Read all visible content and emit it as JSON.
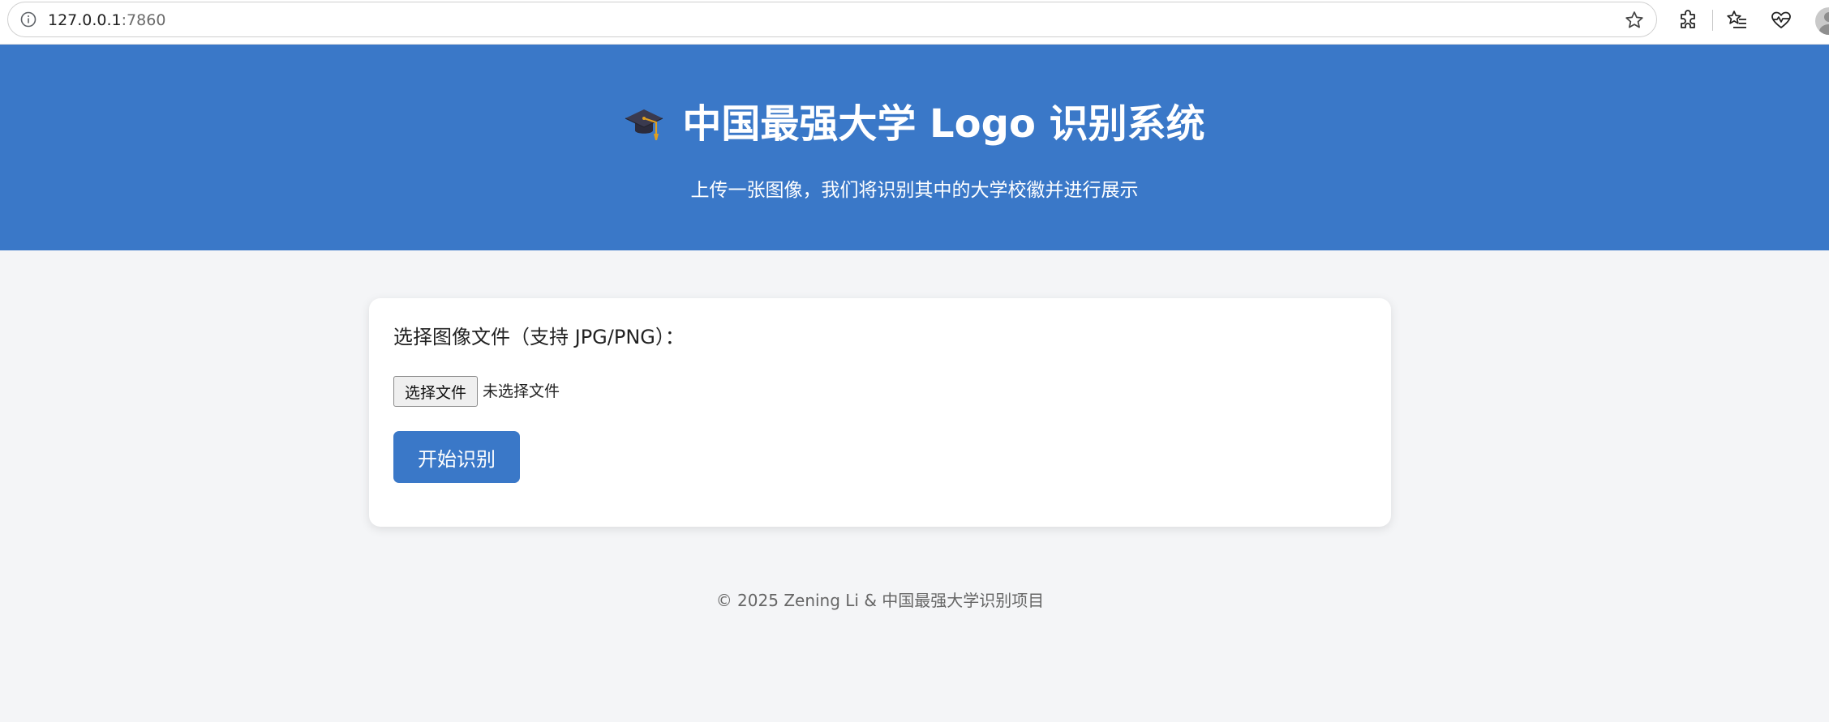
{
  "browser": {
    "url_host": "127.0.0.1",
    "url_port": ":7860",
    "icons": [
      "info-icon",
      "star-icon",
      "extensions-icon",
      "favorites-icon",
      "browser-essentials-icon",
      "profile-avatar"
    ]
  },
  "header": {
    "icon": "graduation-cap-icon",
    "title": "中国最强大学 Logo 识别系统",
    "subtitle": "上传一张图像，我们将识别其中的大学校徽并进行展示",
    "background_color": "#3a78c8"
  },
  "form": {
    "label": "选择图像文件（支持 JPG/PNG）：",
    "file_button_label": "选择文件",
    "file_status": "未选择文件",
    "submit_label": "开始识别",
    "accent_color": "#3a78c8"
  },
  "footer": {
    "text": "© 2025 Zening Li & 中国最强大学识别项目"
  }
}
